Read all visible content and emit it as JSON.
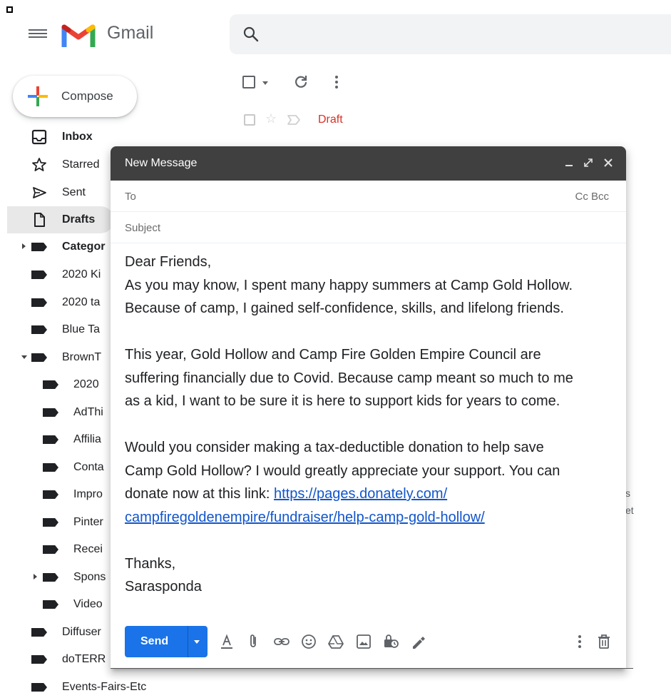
{
  "app": {
    "name": "Gmail"
  },
  "colors": {
    "accent_blue": "#1a73e8",
    "draft_red": "#d93025",
    "compose_header": "#404040",
    "link": "#1155cc"
  },
  "compose_button": {
    "label": "Compose"
  },
  "sidebar": {
    "items": [
      {
        "label": "Inbox",
        "icon": "inbox-icon"
      },
      {
        "label": "Starred",
        "icon": "star-icon"
      },
      {
        "label": "Sent",
        "icon": "send-icon"
      },
      {
        "label": "Drafts",
        "icon": "draft-icon"
      },
      {
        "label": "Categor",
        "icon": "label-icon"
      },
      {
        "label": "2020 Ki",
        "icon": "label-icon"
      },
      {
        "label": "2020 ta",
        "icon": "label-icon"
      },
      {
        "label": "Blue Ta",
        "icon": "label-icon"
      },
      {
        "label": "BrownT",
        "icon": "label-icon"
      },
      {
        "label": "2020",
        "icon": "label-icon"
      },
      {
        "label": "AdThi",
        "icon": "label-icon"
      },
      {
        "label": "Affilia",
        "icon": "label-icon"
      },
      {
        "label": "Conta",
        "icon": "label-icon"
      },
      {
        "label": "Impro",
        "icon": "label-icon"
      },
      {
        "label": "Pinter",
        "icon": "label-icon"
      },
      {
        "label": "Recei",
        "icon": "label-icon"
      },
      {
        "label": "Spons",
        "icon": "label-icon"
      },
      {
        "label": "Video",
        "icon": "label-icon"
      },
      {
        "label": "Diffuser",
        "icon": "label-icon"
      },
      {
        "label": "doTERR",
        "icon": "label-icon"
      },
      {
        "label": "Events-Fairs-Etc",
        "icon": "label-icon"
      }
    ]
  },
  "message_list": {
    "draft_row": {
      "label": "Draft"
    },
    "background_fragments": [
      "s",
      "et"
    ]
  },
  "compose_window": {
    "title": "New Message",
    "to_label": "To",
    "cc_bcc_label": "Cc Bcc",
    "subject_placeholder": "Subject",
    "body": {
      "greeting": "Dear Friends,",
      "p1_line1": "As you may know, I spent many happy summers at Camp Gold Hollow.",
      "p1_line2": "Because of camp, I gained self-confidence, skills, and lifelong friends.",
      "p2_line1": "This year, Gold Hollow and Camp Fire Golden Empire Council are",
      "p2_line2": "suffering financially due to Covid. Because camp meant so much to me",
      "p2_line3": "as a kid, I want to be sure it is here to support kids for years to come.",
      "p3_line1": "Would you consider making a tax-deductible donation to help save",
      "p3_line2": "Camp Gold Hollow? I would greatly appreciate your support. You can",
      "p3_line3_prefix": "donate now at this link: ",
      "link_part1": "https://pages.donately.com/",
      "link_part2": "campfiregoldenempire/fundraiser/help-camp-gold-hollow/",
      "closing": "Thanks,",
      "signature": "Sarasponda"
    },
    "send_label": "Send"
  }
}
